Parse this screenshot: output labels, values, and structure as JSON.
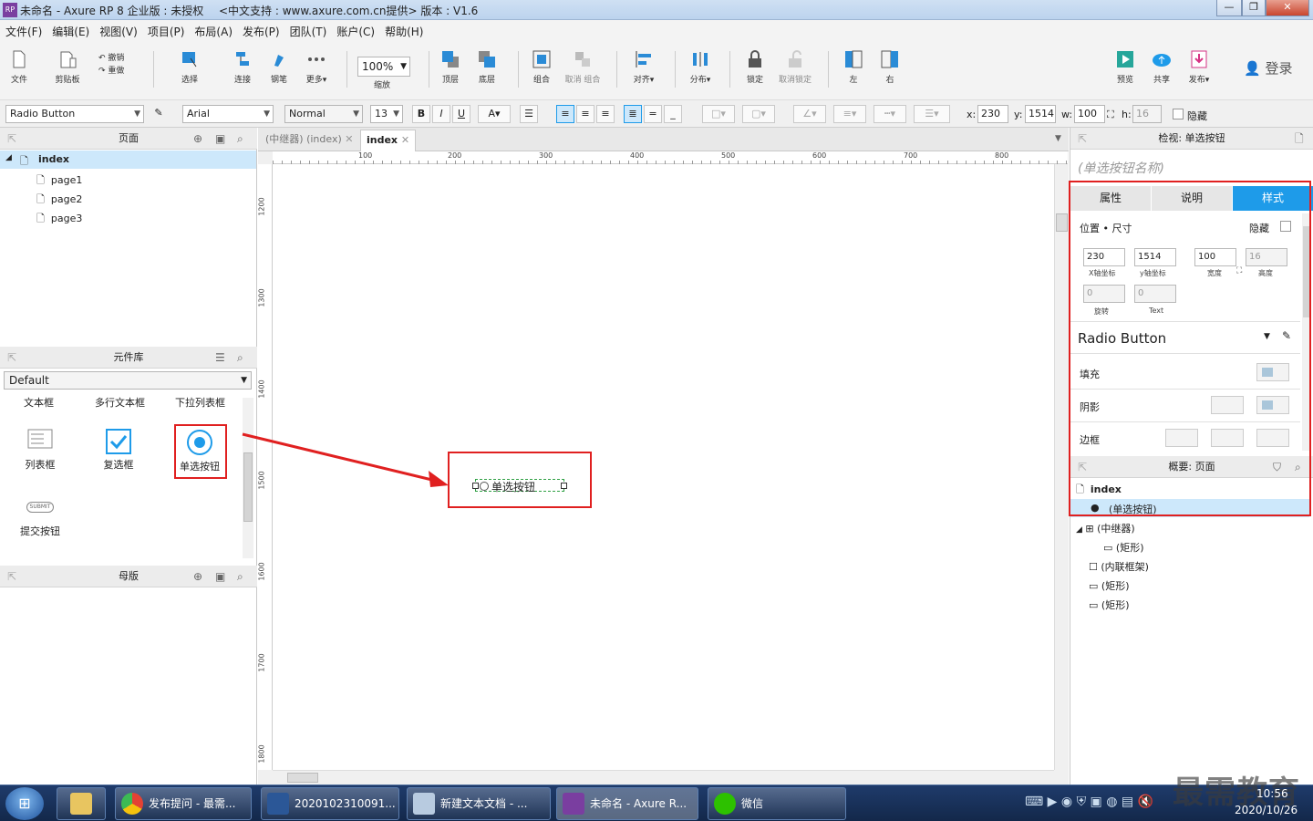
{
  "window": {
    "title": "未命名 - Axure RP 8 企业版 : 未授权",
    "subtitle": "<中文支持 : www.axure.com.cn提供> 版本 : V1.6",
    "app_icon": "RP"
  },
  "menu": [
    "文件(F)",
    "编辑(E)",
    "视图(V)",
    "项目(P)",
    "布局(A)",
    "发布(P)",
    "团队(T)",
    "账户(C)",
    "帮助(H)"
  ],
  "toolbar": {
    "file": "文件",
    "clipboard": "剪贴板",
    "undo": "撤销",
    "redo": "重做",
    "select": "选择",
    "connect": "连接",
    "pen": "钢笔",
    "more": "更多▾",
    "zoom_value": "100%",
    "zoom_label": "缩放",
    "top": "顶层",
    "bottom": "底层",
    "group": "组合",
    "ungroup": "取消 组合",
    "align": "对齐▾",
    "distribute": "分布▾",
    "lock": "锁定",
    "unlock": "取消锁定",
    "left": "左",
    "right": "右",
    "preview": "预览",
    "share": "共享",
    "publish": "发布▾",
    "login": "登录"
  },
  "format": {
    "widget_type": "Radio Button",
    "font": "Arial",
    "style": "Normal",
    "size": "13",
    "x_label": "x:",
    "x": "230",
    "y_label": "y:",
    "y": "1514",
    "w_label": "w:",
    "w": "100",
    "h_label": "h:",
    "h": "16",
    "hidden": "隐藏"
  },
  "pages": {
    "title": "页面",
    "root": "index",
    "children": [
      "page1",
      "page2",
      "page3"
    ]
  },
  "library": {
    "title": "元件库",
    "selected": "Default",
    "top_row": [
      "文本框",
      "多行文本框",
      "下拉列表框"
    ],
    "items": [
      "列表框",
      "复选框",
      "单选按钮",
      "提交按钮"
    ],
    "submit_icon_text": "SUBMIT"
  },
  "masters": {
    "title": "母版"
  },
  "tabs": [
    {
      "label": "(中继器) (index)"
    },
    {
      "label": "index"
    }
  ],
  "ruler": {
    "h": [
      "100",
      "200",
      "300",
      "400",
      "500",
      "600",
      "700",
      "800"
    ],
    "v": [
      "1200",
      "1300",
      "1400",
      "1500",
      "1600",
      "1700",
      "1800"
    ]
  },
  "canvas": {
    "radio_label": "单选按钮"
  },
  "inspector": {
    "title": "检视: 单选按钮",
    "name_placeholder": "(单选按钮名称)",
    "tabs": [
      "属性",
      "说明",
      "样式"
    ],
    "pos_size": "位置 • 尺寸",
    "hidden": "隐藏",
    "x": "230",
    "y": "1514",
    "w": "100",
    "h": "16",
    "x_label": "X轴坐标",
    "y_label": "y轴坐标",
    "w_label": "宽度",
    "h_label": "高度",
    "rotate": "0",
    "text_rotate": "0",
    "rotate_label": "旋转",
    "text_label": "Text",
    "style_name": "Radio Button",
    "fill": "填充",
    "shadow": "阴影",
    "border": "边框"
  },
  "outline": {
    "title": "概要: 页面",
    "page": "index",
    "items": [
      "(单选按钮)",
      "(中继器)",
      "(矩形)",
      "(内联框架)",
      "(矩形)",
      "(矩形)"
    ]
  },
  "taskbar": {
    "items": [
      "发布提问 - 最需...",
      "2020102310091...",
      "新建文本文档 - ...",
      "未命名 - Axure R...",
      "微信"
    ],
    "time": "10:56",
    "date": "2020/10/26",
    "watermark": "最需教育"
  },
  "colors": {
    "accent": "#1e9be9",
    "highlight": "#cde8fb",
    "annotation": "#e02020"
  }
}
